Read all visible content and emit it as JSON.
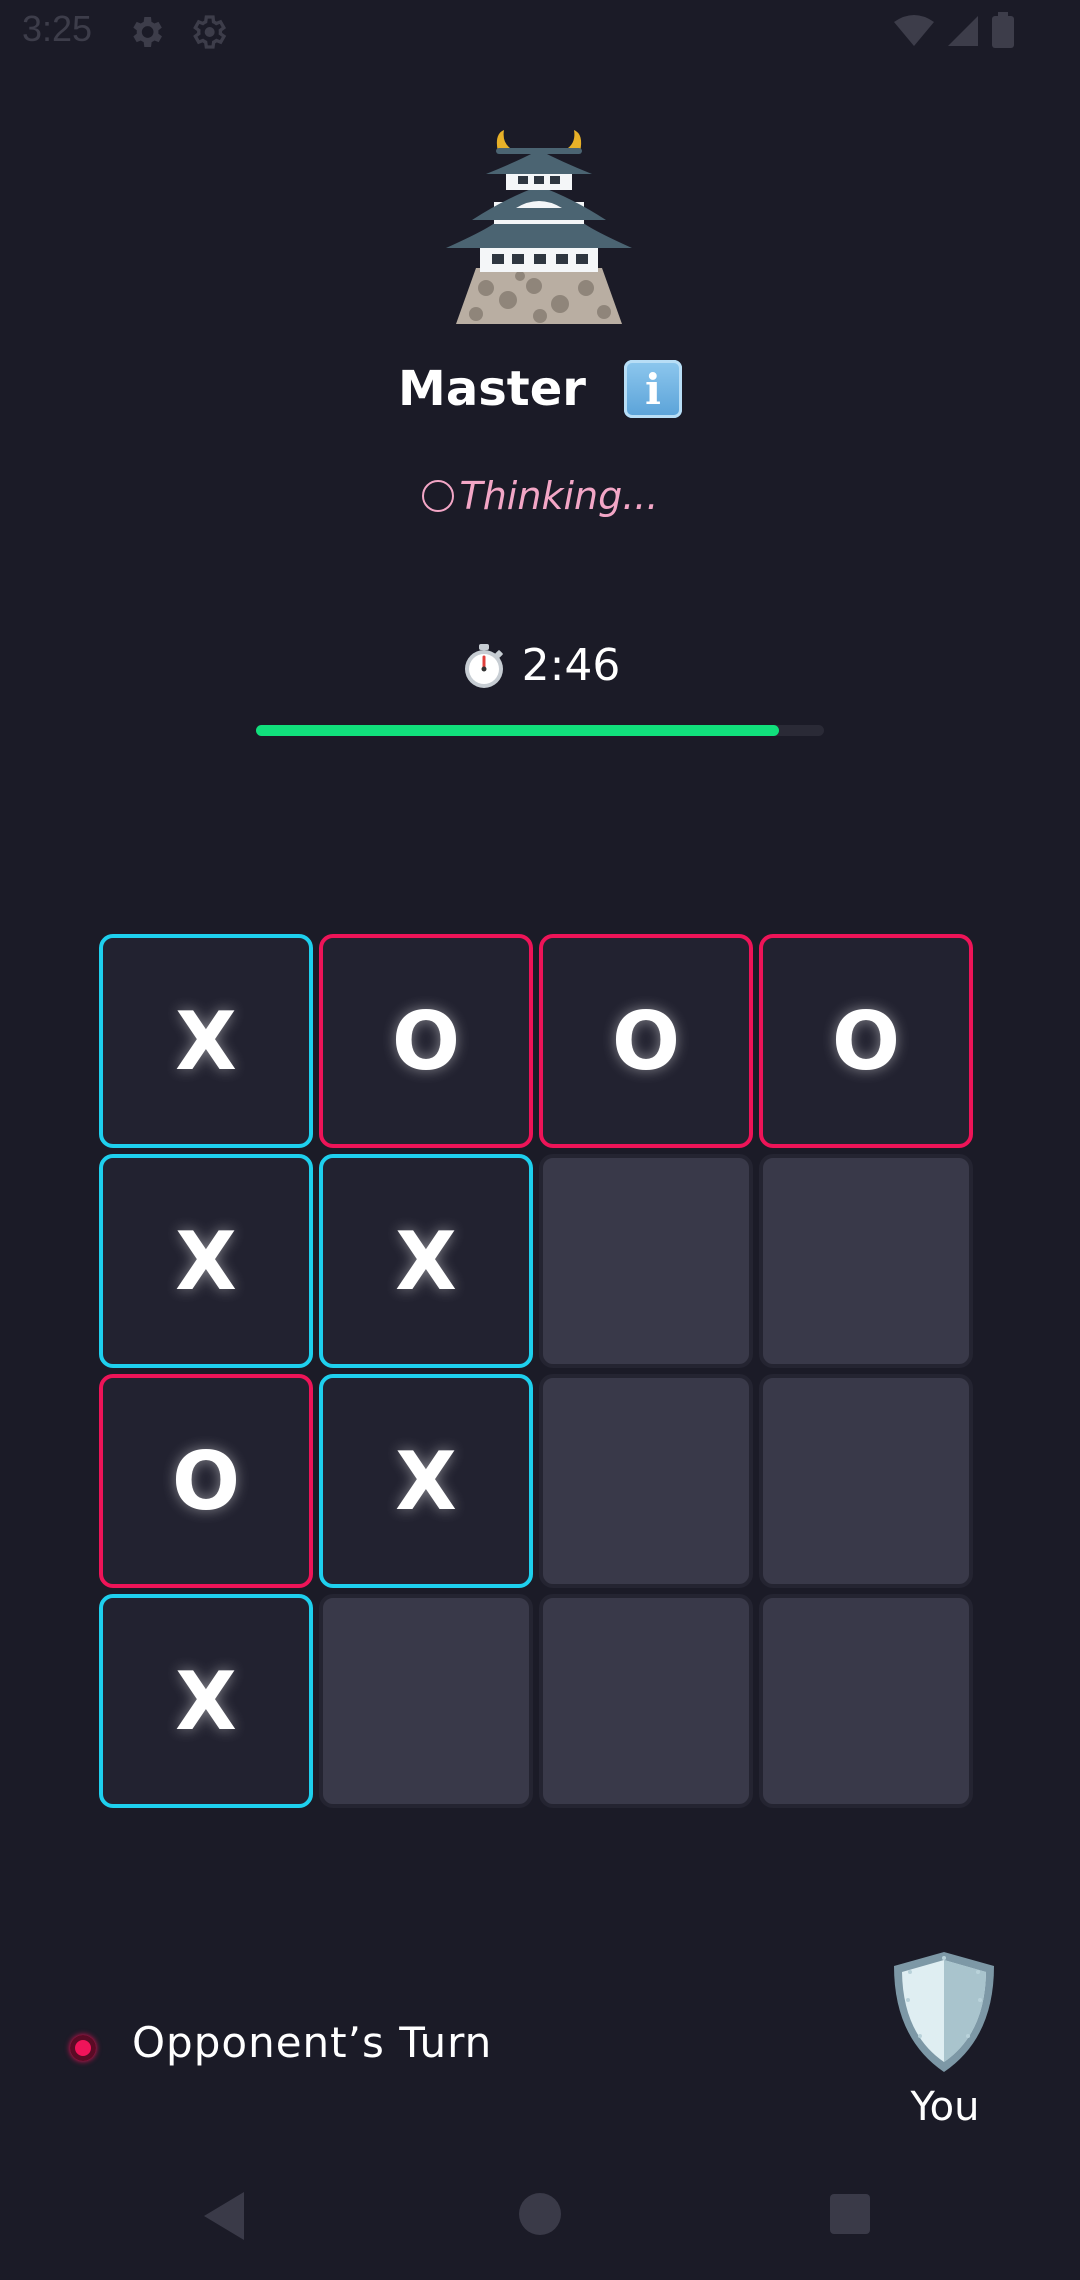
{
  "status_bar": {
    "time": "3:25",
    "icons": [
      "settings-gear-icon",
      "settings-gear-outline-icon",
      "wifi-icon",
      "signal-icon",
      "battery-icon"
    ]
  },
  "header": {
    "emoji": "japanese-castle-icon",
    "title": "Master",
    "info_icon": "information-icon",
    "status": "Thinking...",
    "status_color": "#f3a6c6"
  },
  "timer": {
    "icon": "stopwatch-icon",
    "text": "2:46",
    "progress_fraction": 0.92,
    "progress_color": "#11e07c"
  },
  "board": {
    "size": 4,
    "cells": [
      [
        "X",
        "O",
        "O",
        "O"
      ],
      [
        "X",
        "X",
        "",
        ""
      ],
      [
        "O",
        "X",
        "",
        ""
      ],
      [
        "X",
        "",
        "",
        ""
      ]
    ],
    "x_color": "#1ed0ee",
    "o_color": "#ee1458"
  },
  "footer": {
    "turn_text": "Opponent’s Turn",
    "turn_indicator_color": "#f0145a",
    "player_icon": "shield-icon",
    "player_label": "You"
  },
  "nav_bar": {
    "buttons": [
      "back-icon",
      "home-icon",
      "recents-icon"
    ]
  }
}
